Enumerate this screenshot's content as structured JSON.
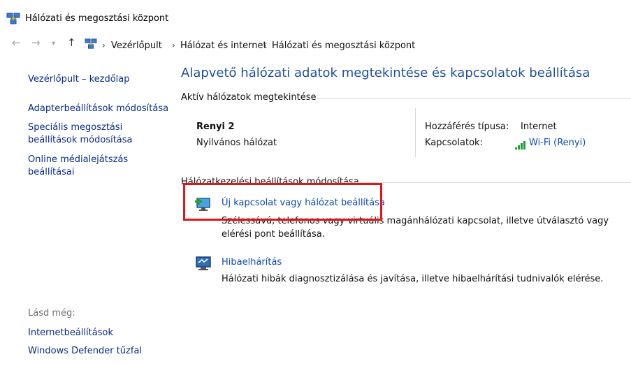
{
  "window": {
    "title": "Hálózati és megosztási központ"
  },
  "address": {
    "breadcrumbs": [
      "Vezérlőpult",
      "Hálózat és internet",
      "Hálózati és megosztási központ"
    ]
  },
  "sidebar": {
    "home": "Vezérlőpult – kezdőlap",
    "links": [
      "Adapterbeállítások módosítása",
      "Speciális megosztási beállítások módosítása",
      "Online médialejátszás beállításai"
    ],
    "see_also_label": "Lásd még:",
    "see_also": [
      "Internetbeállítások",
      "Windows Defender tűzfal"
    ]
  },
  "main": {
    "heading": "Alapvető hálózati adatok megtekintése és kapcsolatok beállítása",
    "active_section": "Aktív hálózatok megtekintése",
    "network_name": "Renyi 2",
    "network_type": "Nyilvános hálózat",
    "access_type_label": "Hozzáférés típusa:",
    "access_type_value": "Internet",
    "connections_label": "Kapcsolatok:",
    "connections_value": "Wi-Fi (Renyi)",
    "change_section": "Hálózatkezelési beállítások módosítása",
    "tasks": [
      {
        "title": "Új kapcsolat vagy hálózat beállítása",
        "description": "Szélessávú, telefonos vagy virtuális magánhálózati kapcsolat, illetve útválasztó vagy elérési pont beállítása."
      },
      {
        "title": "Hibaelhárítás",
        "description": "Hálózati hibák diagnosztizálása és javítása, illetve hibaelhárítási tudnivalók elérése."
      }
    ]
  },
  "colors": {
    "link": "#0a4bb3",
    "heading": "#1e4f9c",
    "highlight": "#e2151b"
  }
}
